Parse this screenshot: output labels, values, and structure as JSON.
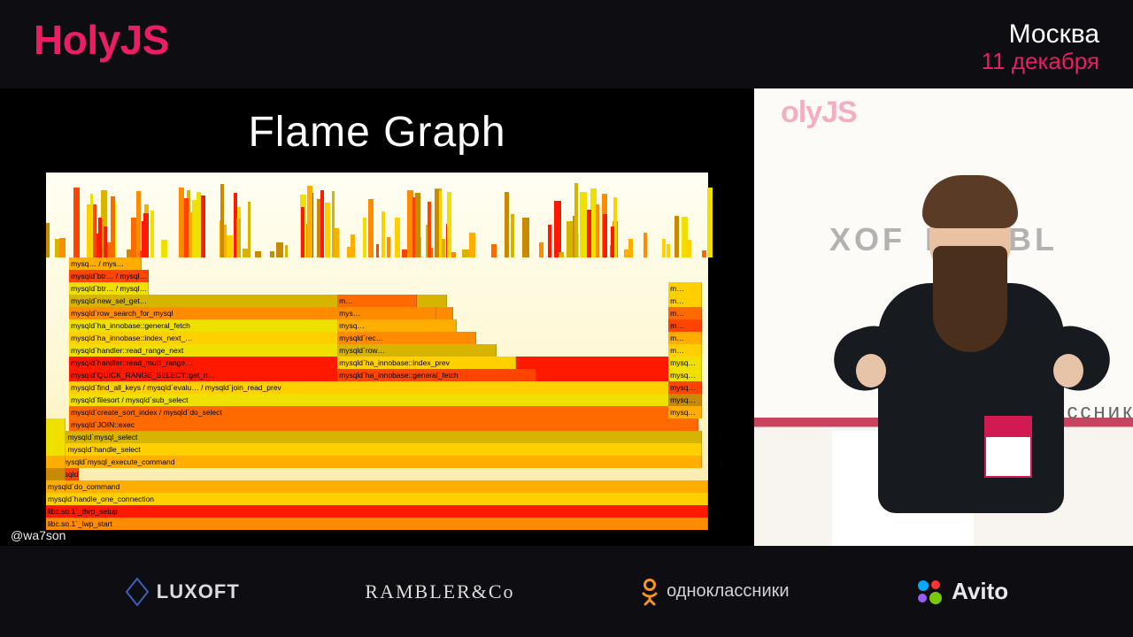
{
  "header": {
    "brand": "HolyJS",
    "city": "Москва",
    "date": "11 декабря"
  },
  "slide": {
    "title": "Flame Graph",
    "handle": "@wa7son",
    "frames_bottom": [
      "libc.so.1`_lwp_start",
      "libc.so.1`_thrp_setup",
      "mysqld`handle_one_connection",
      "mysqld`do_command",
      "mysqld`mysql_parse",
      "mysqld`mysql_execute_command",
      "mysqld`handle_select",
      "mysqld`mysql_select",
      "mysqld`JOIN::exec",
      "mysqld`create_sort_index / mysqld`do_select",
      "mysqld`filesort / mysqld`sub_select",
      "mysqld`find_all_keys / mysqld`evalu… / mysqld`join_read_prev",
      "mysqld`QUICK_RANGE_SELECT::get_n…",
      "mysqld`handler::read_multi_range…",
      "mysqld`handler::read_range_next",
      "mysqld`ha_innobase::index_next_…",
      "mysqld`ha_innobase::general_fetch",
      "mysqld`row_search_for_mysql",
      "mysqld`new_sel_get…",
      "mysqld`btr… / mysql…",
      "mysqld`btr… / mysql…",
      "mysq… / mys…"
    ],
    "frames_mid_short": [
      "mysqld`ha_innobase::general_fetch",
      "mysqld`ha_innobase::index_prev",
      "mysqld`row…",
      "mysqld`rec…",
      "mysq…",
      "mys…",
      "m…"
    ]
  },
  "camera": {
    "wall_left": "XOF",
    "wall_right": "RAMBL",
    "wall_sub": "ассники",
    "brand_top": "olyJS"
  },
  "sponsors": {
    "luxoft": "LUXOFT",
    "rambler": "RAMBLER&Cᴏ",
    "ok": "одноклассники",
    "avito": "Avito"
  }
}
